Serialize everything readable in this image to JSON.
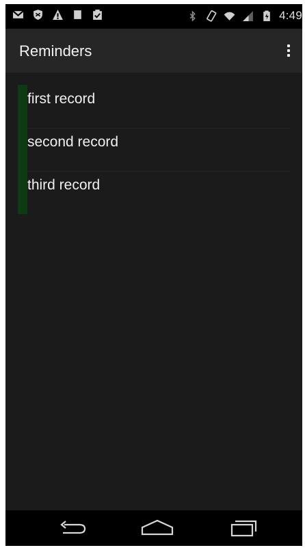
{
  "status_bar": {
    "left_icons": [
      "gmail-icon",
      "shield-icon",
      "warning-icon",
      "square-icon",
      "clipboard-check-icon"
    ],
    "right_icons": [
      "bluetooth-icon",
      "rotate-icon",
      "wifi-icon",
      "signal-icon",
      "battery-icon"
    ],
    "time": "4:49"
  },
  "action_bar": {
    "title": "Reminders",
    "overflow_icon": "overflow-menu-icon"
  },
  "reminders": [
    {
      "label": "first record"
    },
    {
      "label": "second record"
    },
    {
      "label": "third record"
    }
  ],
  "colors": {
    "background": "#1b1b1b",
    "action_bar": "#262626",
    "row_marker": "#0d3a12",
    "text": "#f0f0f0"
  },
  "nav_bar": {
    "buttons": [
      "back-icon",
      "home-icon",
      "recents-icon"
    ]
  }
}
